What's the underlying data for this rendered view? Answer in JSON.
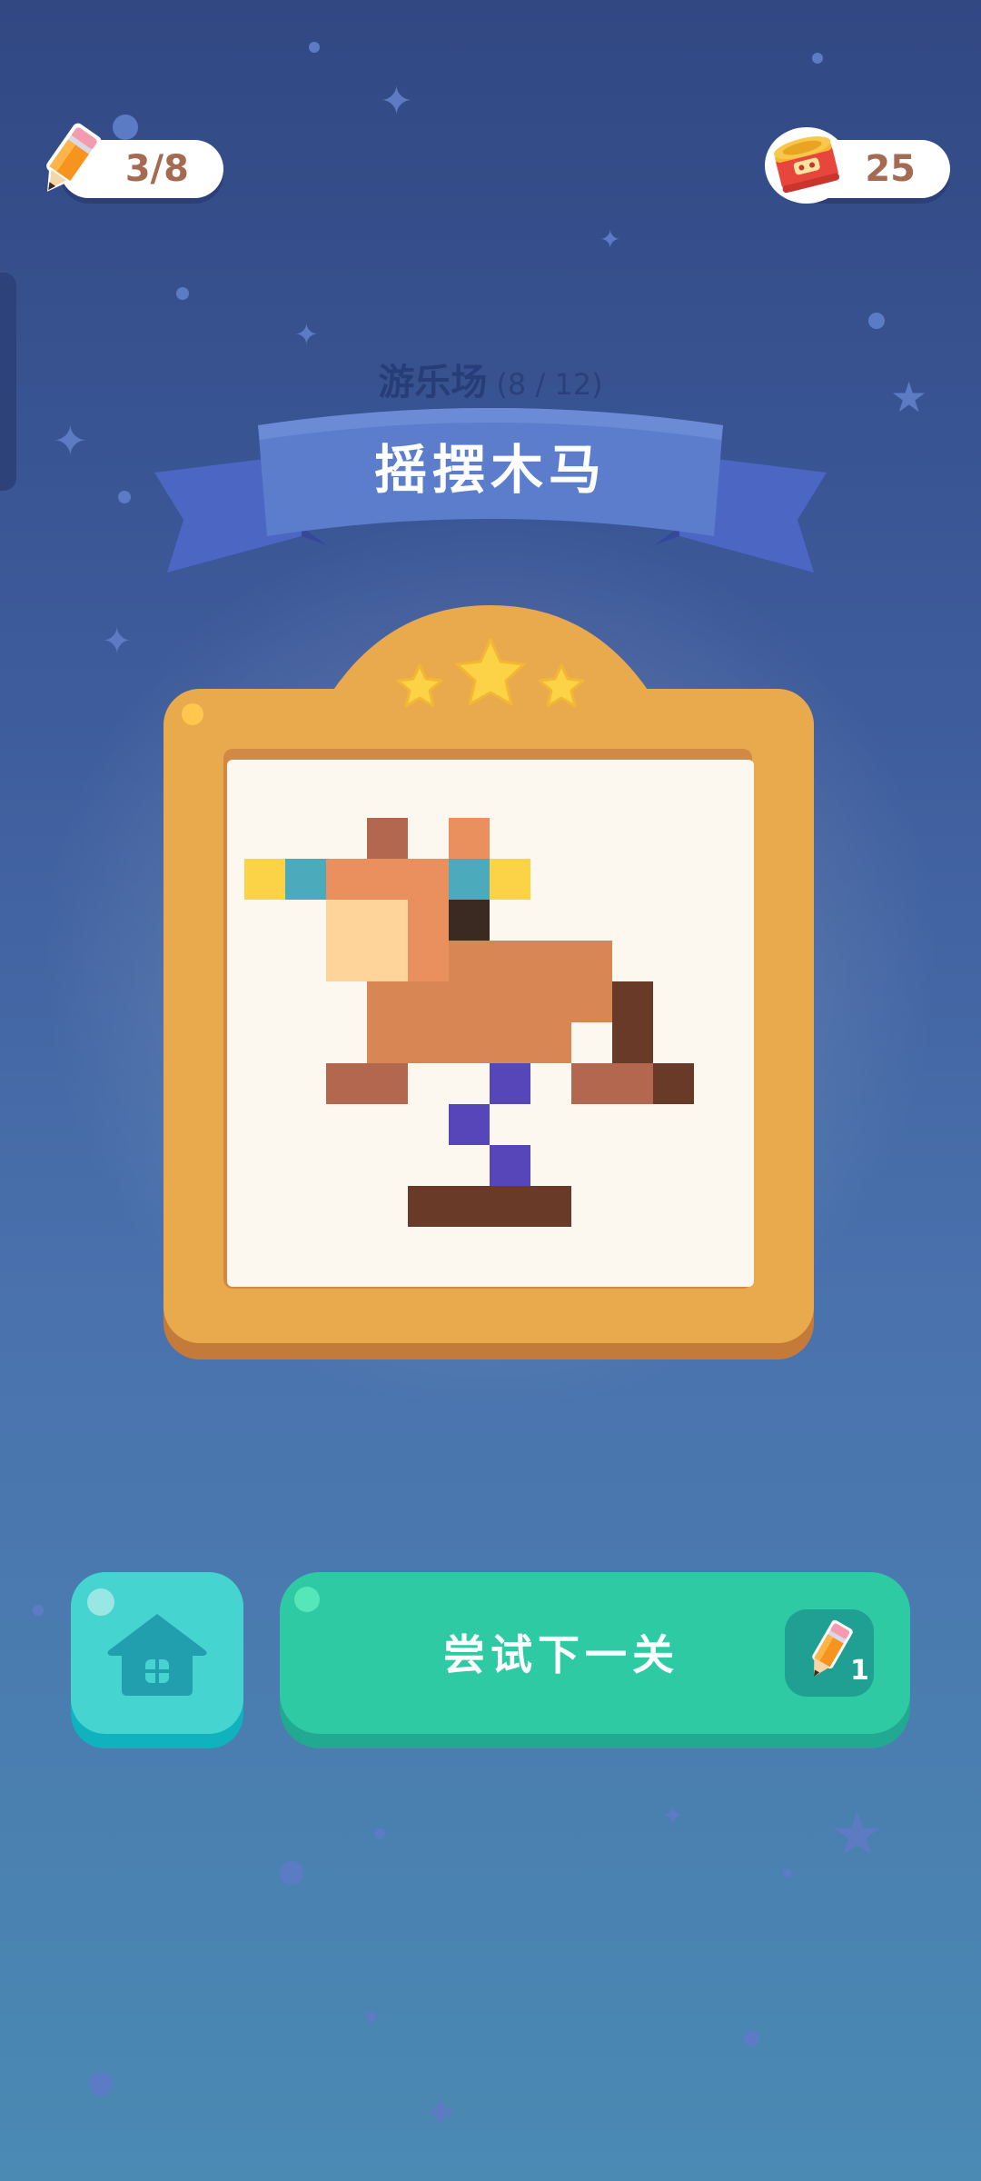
{
  "hud": {
    "pencil_count": "3/8",
    "coins": "25"
  },
  "level": {
    "category": "游乐场",
    "progress": "(8 / 12)",
    "title": "摇摆木马",
    "stars_earned": 3
  },
  "artwork": {
    "grid_size": 13,
    "palette": {
      "Y": "#fcd246",
      "T": "#4baabc",
      "B": "#b2674e",
      "O": "#e9905e",
      "S": "#ffd49b",
      "E": "#3a2a22",
      "M": "#d98655",
      "D": "#6a3a28",
      "P": "#5646b9",
      "W": "#fcf8ef"
    },
    "rows": [
      ".............",
      "...B.O.......",
      "YTOOOTY......",
      "..SSOE.......",
      "..SSOMMMM....",
      "...MMMMMMD...",
      "...MMMMMWD...",
      "..BB..P.BBD..",
      ".....P.......",
      "......P......",
      "....DDDD.....",
      ".............",
      "............."
    ]
  },
  "buttons": {
    "home_icon": "house-icon",
    "next_label": "尝试下一关",
    "next_cost": "1"
  },
  "colors": {
    "frame": "#e8aa4d",
    "primary_button": "#2ecaa4",
    "home_button": "#45d4cf",
    "star": "#fcd246"
  }
}
